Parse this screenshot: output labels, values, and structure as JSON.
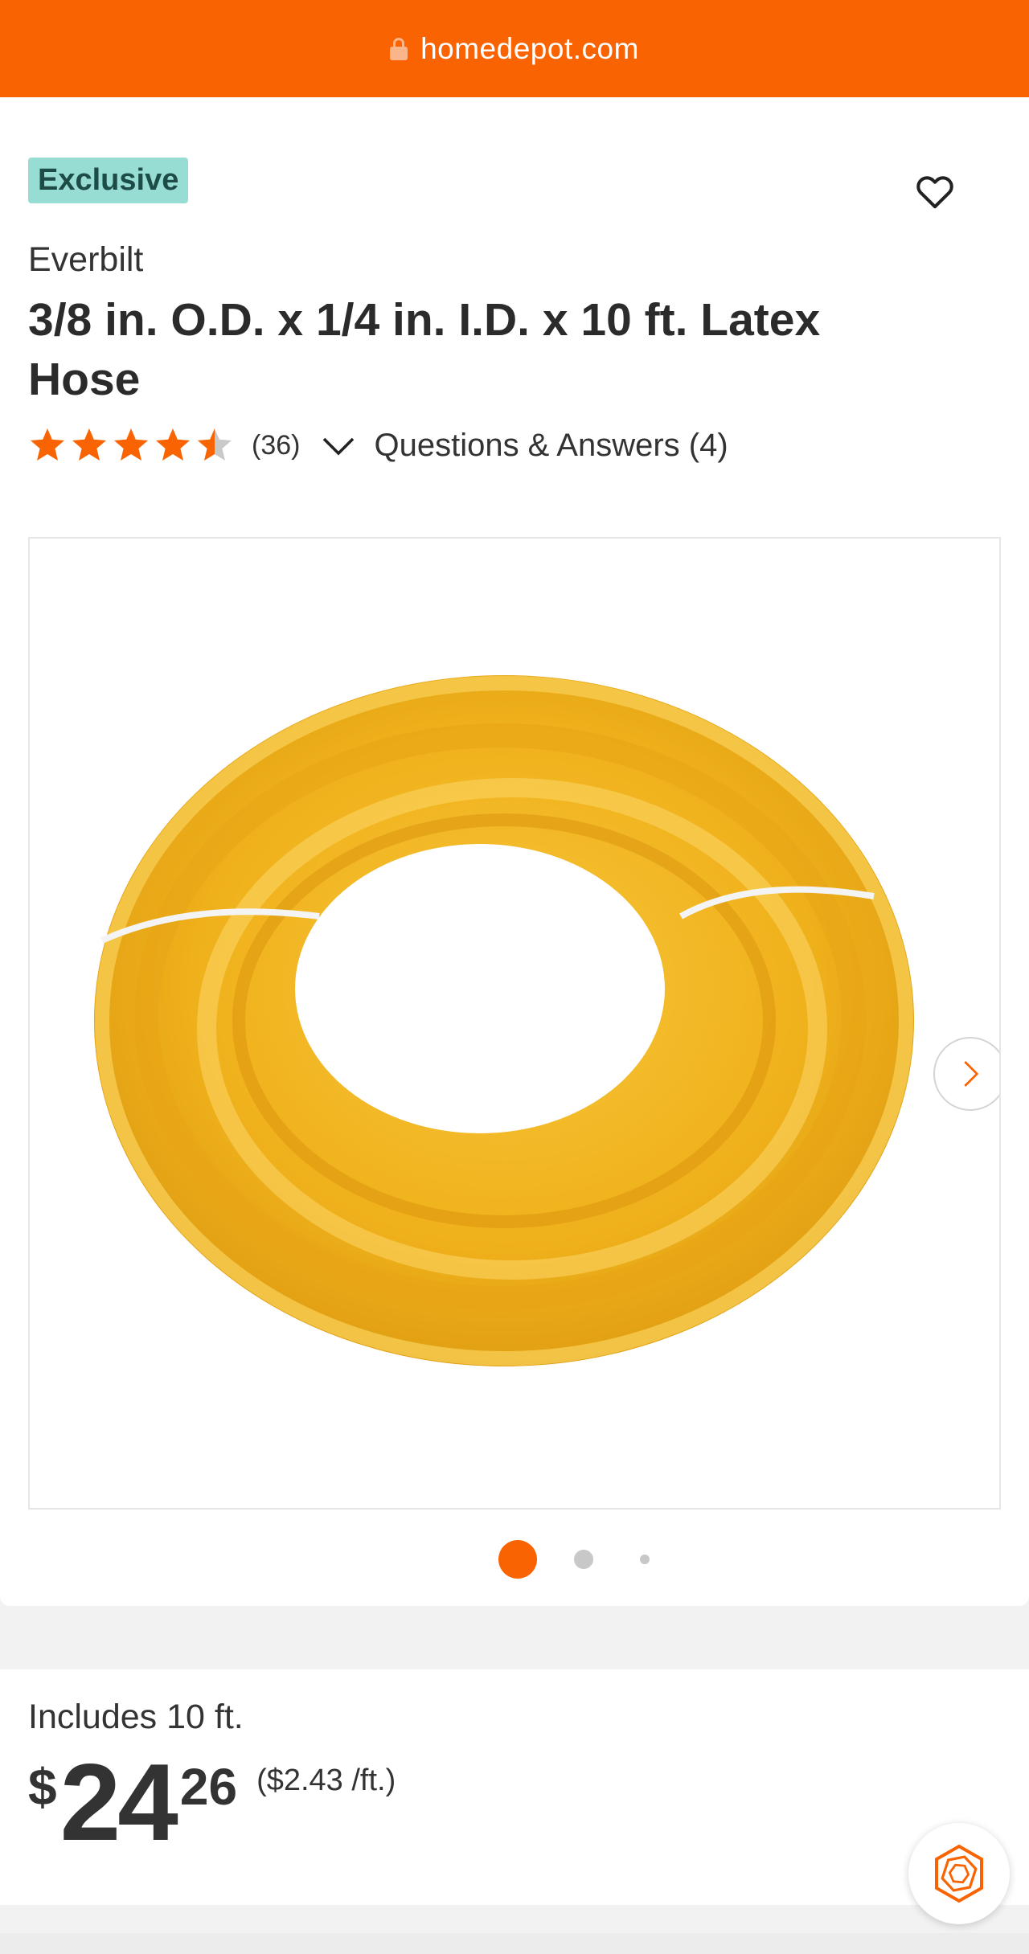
{
  "browser": {
    "url": "homedepot.com"
  },
  "product": {
    "badge": "Exclusive",
    "brand": "Everbilt",
    "title": "3/8 in. O.D. x 1/4 in. I.D. x 10 ft. Latex Hose",
    "rating": 4.5,
    "review_count": "(36)",
    "qa_link": "Questions & Answers (4)",
    "image_alt": "Yellow latex hose coil"
  },
  "gallery": {
    "image_count": 3,
    "active_index": 0
  },
  "pricing": {
    "includes": "Includes 10 ft.",
    "currency": "$",
    "dollars": "24",
    "cents": "26",
    "unit_price": "($2.43 /ft.)"
  },
  "colors": {
    "brand_orange": "#f96302",
    "badge_bg": "#98ddd4",
    "star": "#f96302"
  },
  "icons": [
    "lock-icon",
    "heart-icon",
    "star-icon",
    "chevron-down-icon",
    "chevron-right-icon",
    "assistant-icon"
  ]
}
